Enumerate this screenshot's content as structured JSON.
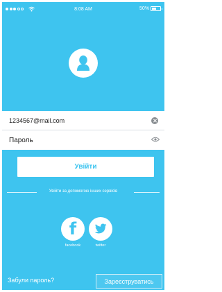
{
  "status_bar": {
    "time": "8:08 AM",
    "battery": "50%",
    "battery_level": 0.5
  },
  "login_form": {
    "email_value": "1234567@mail.com",
    "password_placeholder": "Пароль",
    "login_label": "Увійти"
  },
  "social": {
    "divider_text": "Увійти за допомогою інших сервісів",
    "facebook_label": "facebook",
    "twitter_label": "twitter"
  },
  "footer": {
    "forgot_label": "Забули пароль?",
    "register_label": "Зареєструватись"
  },
  "colors": {
    "accent": "#3ec4ef",
    "surface": "#ffffff"
  }
}
